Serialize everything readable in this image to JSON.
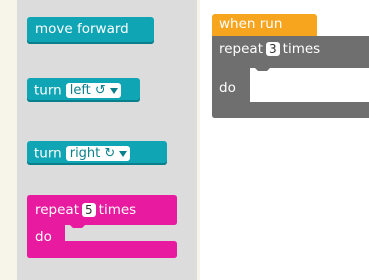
{
  "toolbox": {
    "move_forward": "move forward",
    "turn_left": {
      "label": "turn",
      "option": "left ↺"
    },
    "turn_right": {
      "label": "turn",
      "option": "right ↻"
    },
    "repeat": {
      "prefix": "repeat",
      "count": "5",
      "suffix": "times",
      "do": "do"
    }
  },
  "workspace": {
    "when_run": "when run",
    "repeat": {
      "prefix": "repeat",
      "count": "3",
      "suffix": "times",
      "do": "do"
    }
  },
  "colors": {
    "motion": "#0fa5b5",
    "loop_toolbox": "#e81aa0",
    "event": "#f7a51e",
    "loop_workspace": "#6f6f6f"
  }
}
